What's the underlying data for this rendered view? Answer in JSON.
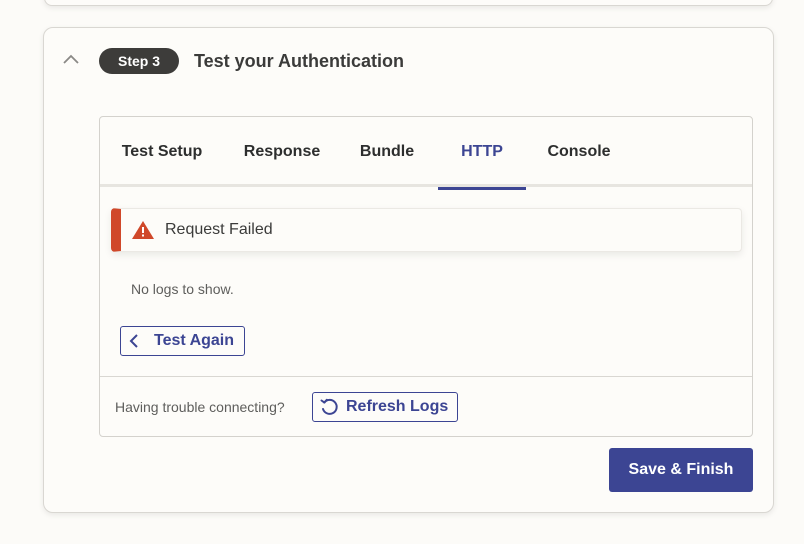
{
  "step": {
    "badge": "Step 3",
    "title": "Test your Authentication",
    "collapse_icon": "chevron-up-icon"
  },
  "tabs": [
    {
      "label": "Test Setup",
      "active": false
    },
    {
      "label": "Response",
      "active": false
    },
    {
      "label": "Bundle",
      "active": false
    },
    {
      "label": "HTTP",
      "active": true
    },
    {
      "label": "Console",
      "active": false
    }
  ],
  "alert": {
    "icon": "warning-icon",
    "message": "Request Failed",
    "color": "#d0482a"
  },
  "logs": {
    "empty_text": "No logs to show."
  },
  "buttons": {
    "test_again": "Test Again",
    "refresh_logs": "Refresh Logs",
    "save_finish": "Save & Finish"
  },
  "footer": {
    "trouble_text": "Having trouble connecting?"
  },
  "colors": {
    "accent": "#3c4593",
    "badge_bg": "#3d3c3a",
    "error": "#d0482a"
  }
}
